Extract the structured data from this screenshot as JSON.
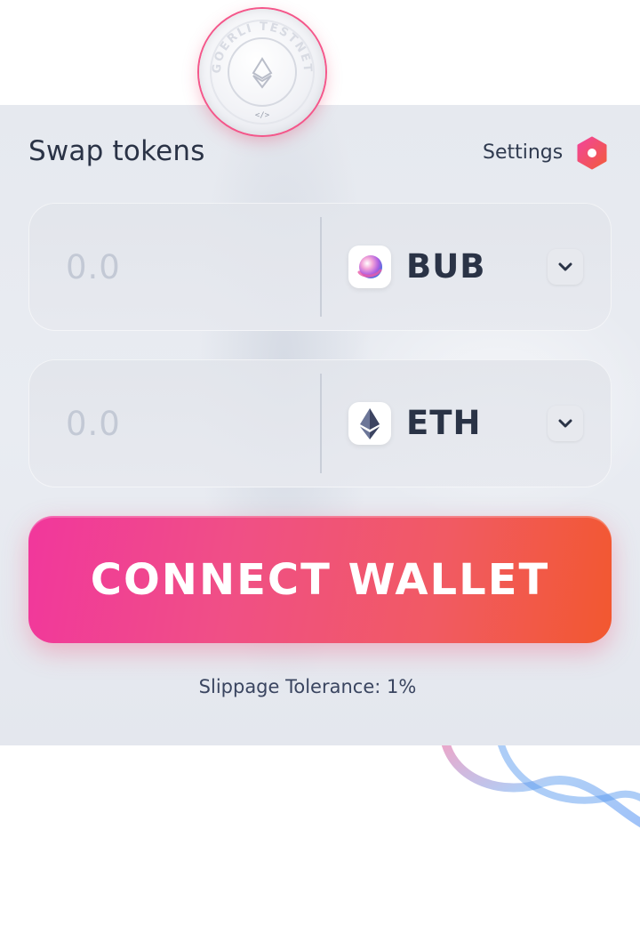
{
  "coin": {
    "text": "GOERLI TESTNET",
    "icon": "ethereum-icon",
    "code_icon": "code-icon"
  },
  "header": {
    "title": "Swap tokens",
    "settings_label": "Settings",
    "settings_icon": "hexagon-settings-icon"
  },
  "swap": {
    "from": {
      "amount_placeholder": "0.0",
      "token_symbol": "BUB",
      "token_icon": "bub-token-icon"
    },
    "to": {
      "amount_placeholder": "0.0",
      "token_symbol": "ETH",
      "token_icon": "ethereum-icon"
    }
  },
  "connect_button": {
    "label": "CONNECT WALLET"
  },
  "slippage": {
    "text": "Slippage Tolerance:  1%"
  },
  "colors": {
    "accent_start": "#f1379c",
    "accent_end": "#f2582f",
    "text_primary": "#2a3346",
    "placeholder": "#c3c9d5"
  }
}
